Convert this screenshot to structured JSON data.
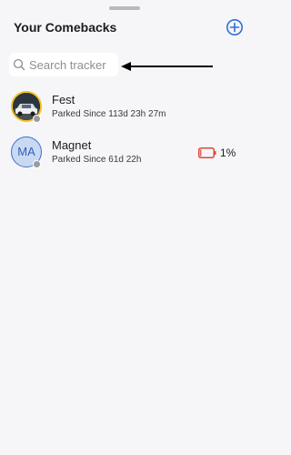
{
  "header": {
    "title": "Your Comebacks"
  },
  "search": {
    "placeholder": "Search tracker",
    "value": ""
  },
  "trackers": [
    {
      "name": "Fest",
      "subtitle": "Parked Since 113d 23h 27m",
      "avatar": "car-photo",
      "status_color": "#9a9a9f"
    },
    {
      "name": "Magnet",
      "subtitle": "Parked Since 61d 22h",
      "initials": "MA",
      "status_color": "#9a9a9f",
      "battery_percent": "1%",
      "battery_level": 0.01,
      "battery_color": "#e0473c"
    }
  ],
  "colors": {
    "accent": "#2f6fd6",
    "background": "#f6f6f8"
  }
}
